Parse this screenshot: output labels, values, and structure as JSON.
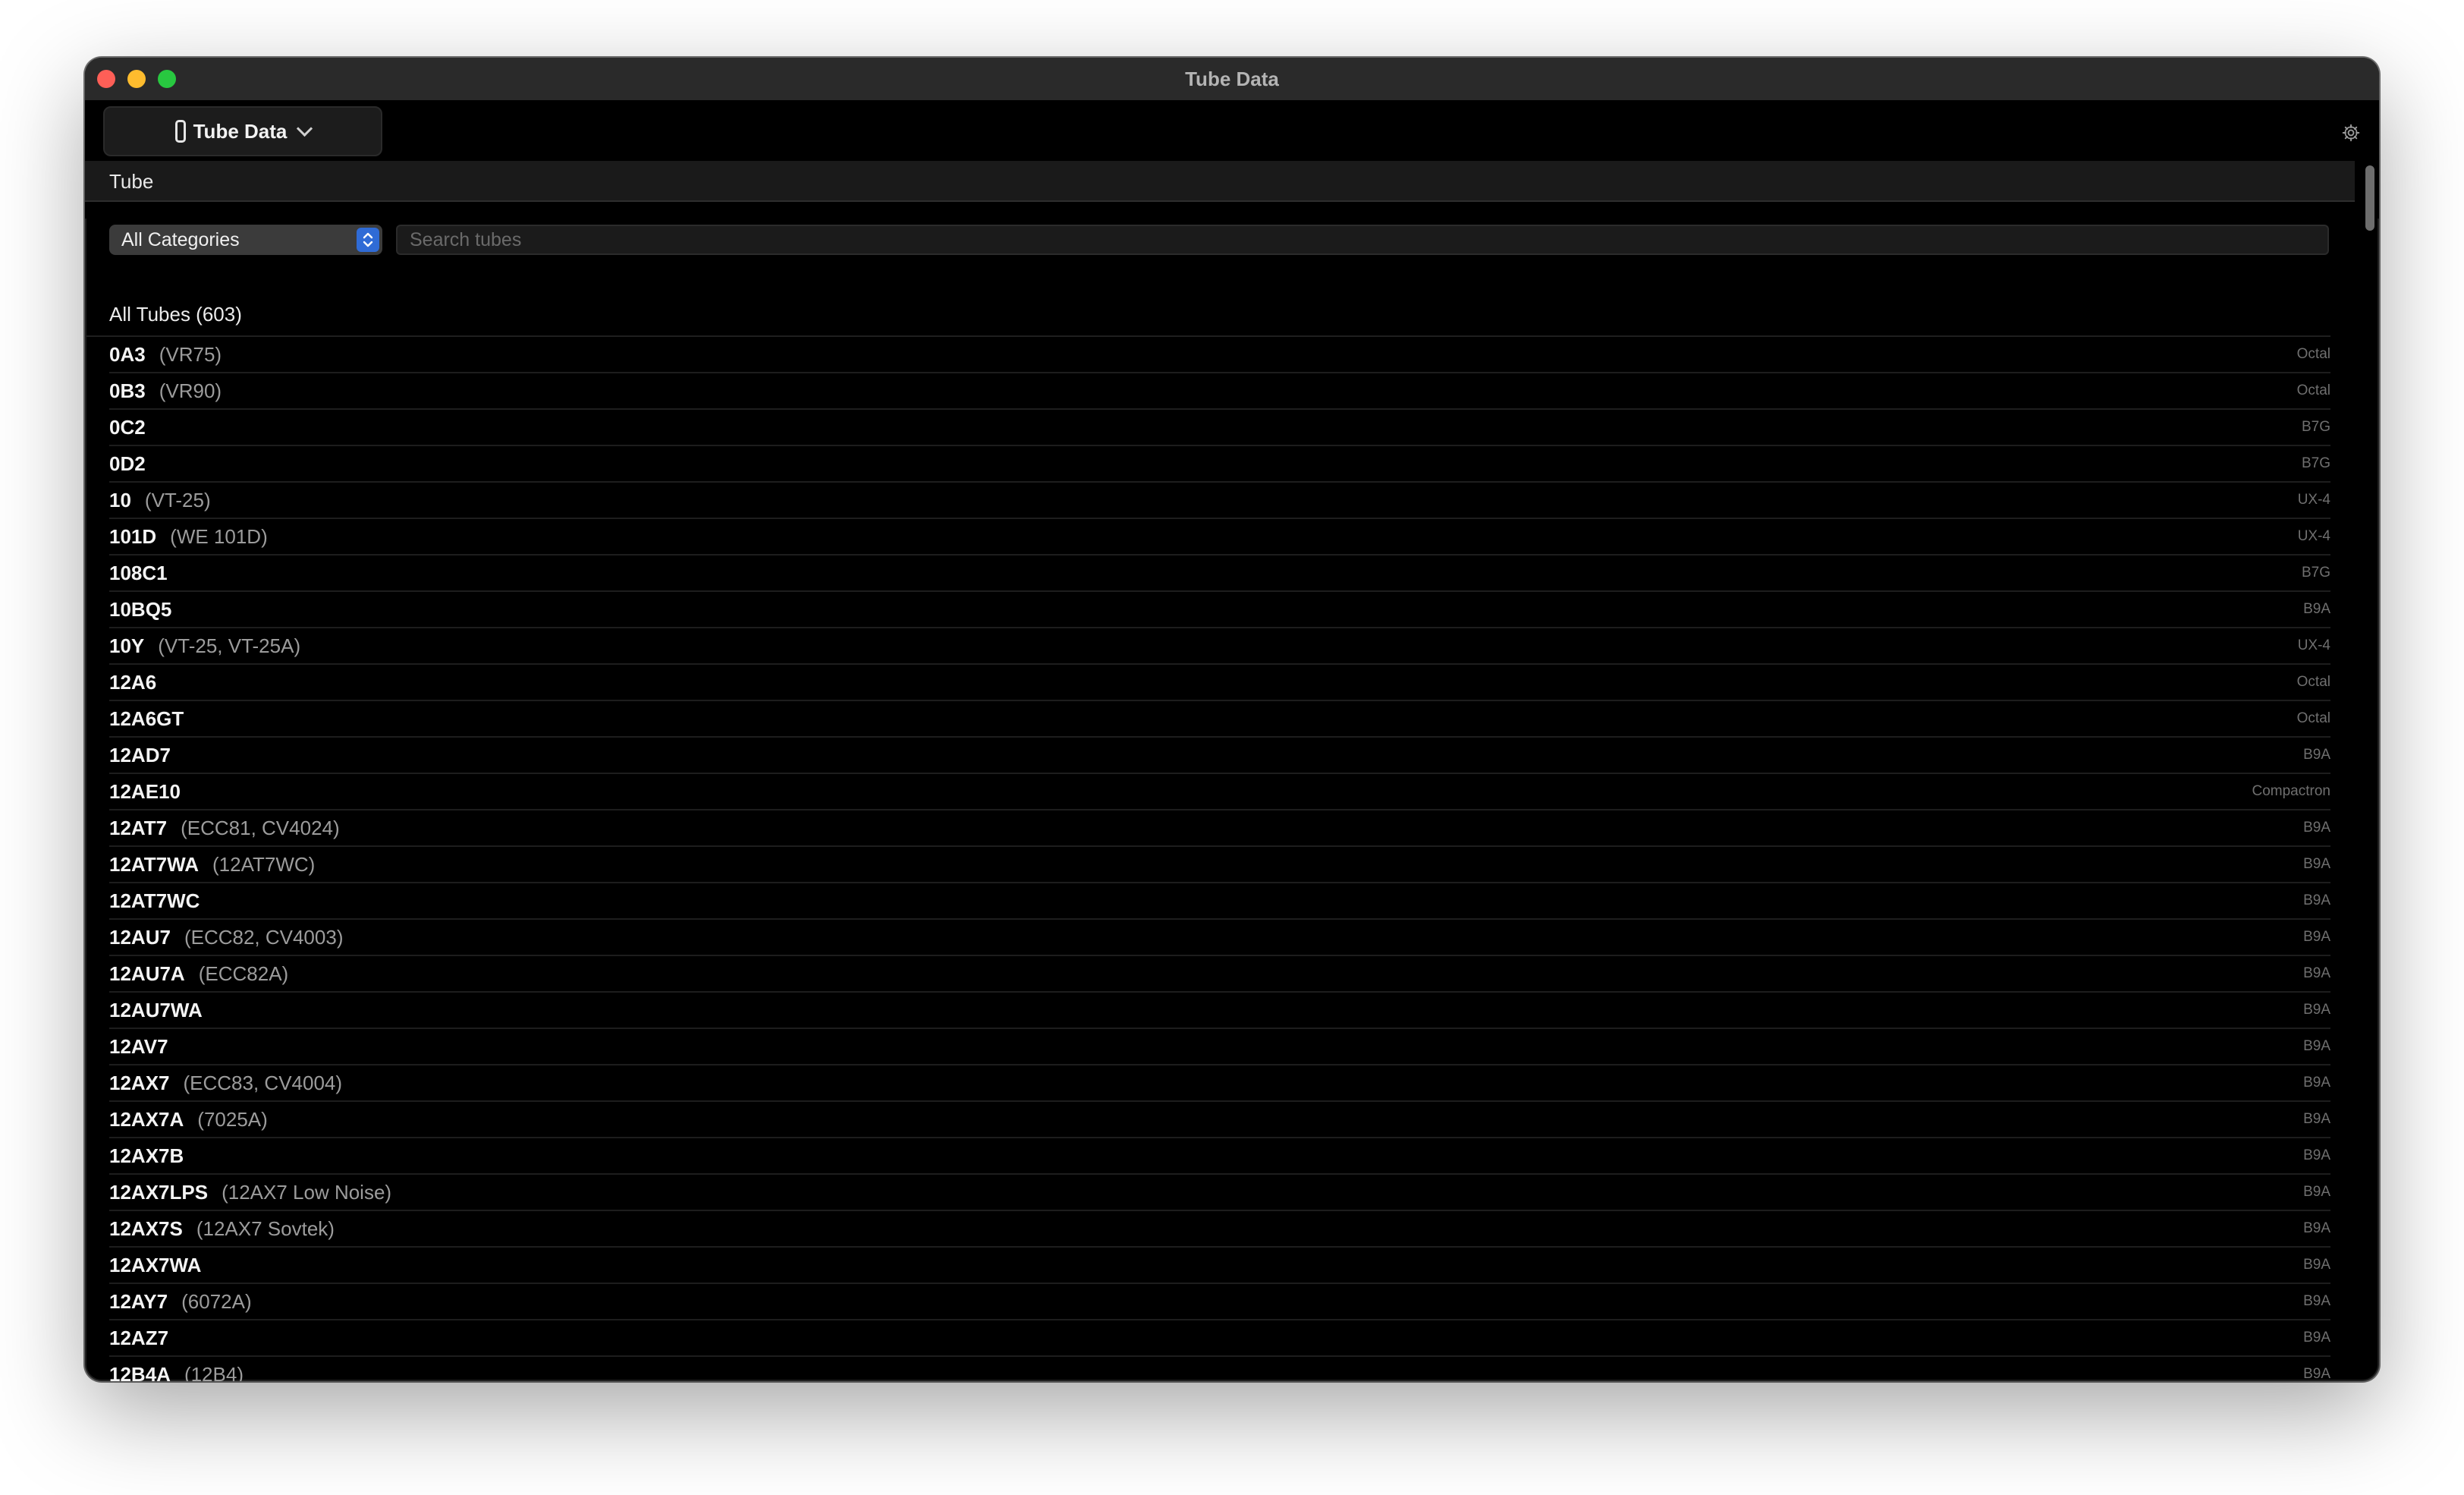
{
  "window": {
    "title": "Tube Data"
  },
  "toolbar": {
    "picker_label": "Tube Data"
  },
  "section": {
    "header": "Tube"
  },
  "filter": {
    "category_selected": "All Categories",
    "search_placeholder": "Search tubes"
  },
  "list": {
    "title": "All Tubes (603)",
    "rows": [
      {
        "name": "0A3",
        "alias": "(VR75)",
        "base": "Octal"
      },
      {
        "name": "0B3",
        "alias": "(VR90)",
        "base": "Octal"
      },
      {
        "name": "0C2",
        "alias": "",
        "base": "B7G"
      },
      {
        "name": "0D2",
        "alias": "",
        "base": "B7G"
      },
      {
        "name": "10",
        "alias": "(VT-25)",
        "base": "UX-4"
      },
      {
        "name": "101D",
        "alias": "(WE 101D)",
        "base": "UX-4"
      },
      {
        "name": "108C1",
        "alias": "",
        "base": "B7G"
      },
      {
        "name": "10BQ5",
        "alias": "",
        "base": "B9A"
      },
      {
        "name": "10Y",
        "alias": "(VT-25, VT-25A)",
        "base": "UX-4"
      },
      {
        "name": "12A6",
        "alias": "",
        "base": "Octal"
      },
      {
        "name": "12A6GT",
        "alias": "",
        "base": "Octal"
      },
      {
        "name": "12AD7",
        "alias": "",
        "base": "B9A"
      },
      {
        "name": "12AE10",
        "alias": "",
        "base": "Compactron"
      },
      {
        "name": "12AT7",
        "alias": "(ECC81, CV4024)",
        "base": "B9A"
      },
      {
        "name": "12AT7WA",
        "alias": "(12AT7WC)",
        "base": "B9A"
      },
      {
        "name": "12AT7WC",
        "alias": "",
        "base": "B9A"
      },
      {
        "name": "12AU7",
        "alias": "(ECC82, CV4003)",
        "base": "B9A"
      },
      {
        "name": "12AU7A",
        "alias": "(ECC82A)",
        "base": "B9A"
      },
      {
        "name": "12AU7WA",
        "alias": "",
        "base": "B9A"
      },
      {
        "name": "12AV7",
        "alias": "",
        "base": "B9A"
      },
      {
        "name": "12AX7",
        "alias": "(ECC83, CV4004)",
        "base": "B9A"
      },
      {
        "name": "12AX7A",
        "alias": "(7025A)",
        "base": "B9A"
      },
      {
        "name": "12AX7B",
        "alias": "",
        "base": "B9A"
      },
      {
        "name": "12AX7LPS",
        "alias": "(12AX7 Low Noise)",
        "base": "B9A"
      },
      {
        "name": "12AX7S",
        "alias": "(12AX7 Sovtek)",
        "base": "B9A"
      },
      {
        "name": "12AX7WA",
        "alias": "",
        "base": "B9A"
      },
      {
        "name": "12AY7",
        "alias": "(6072A)",
        "base": "B9A"
      },
      {
        "name": "12AZ7",
        "alias": "",
        "base": "B9A"
      },
      {
        "name": "12B4A",
        "alias": "(12B4)",
        "base": "B9A"
      }
    ]
  }
}
